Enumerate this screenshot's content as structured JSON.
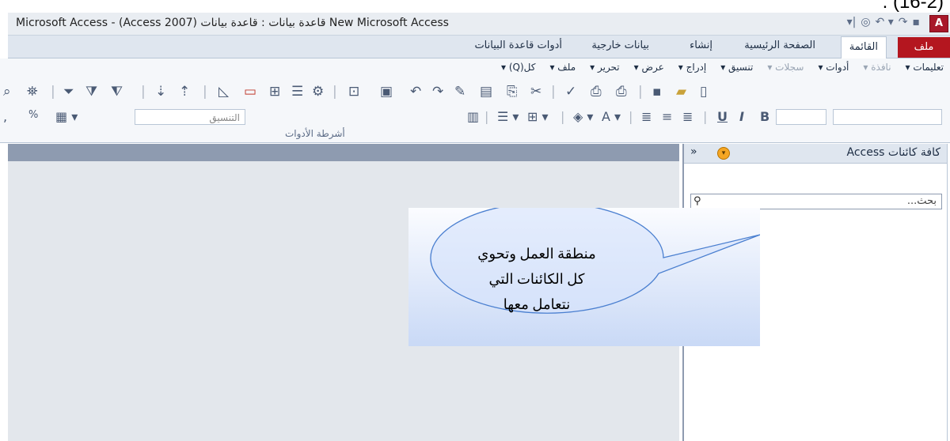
{
  "page": {
    "corner_caption": "(16-2) ."
  },
  "titlebar": {
    "title": "Microsoft Access - (Access 2007) قاعدة بيانات : قاعدة بيانات New Microsoft Access",
    "logo_letter": "A",
    "qat_icons": [
      "save-icon",
      "redo-icon",
      "undo-icon",
      "custom-icon",
      "customize-icon"
    ]
  },
  "tabs": {
    "file": "ملف",
    "items": [
      "القائمة",
      "الصفحة الرئيسية",
      "إنشاء",
      "بيانات خارجية",
      "أدوات قاعدة البيانات"
    ]
  },
  "menu": {
    "items": [
      "كل(Q) ▾",
      "ملف ▾",
      "تحرير ▾",
      "عرض ▾",
      "إدراج ▾",
      "تنسيق ▾",
      "سجلات ▾",
      "أدوات ▾",
      "نافذة ▾",
      "تعليمات ▾"
    ],
    "disabled": [
      6,
      8
    ]
  },
  "format_row": {
    "font_combo": "",
    "size_combo": "",
    "format_combo": "التنسيق",
    "percent": "%",
    "comma": ","
  },
  "ribbon": {
    "group_label": "أشرطة الأدوات"
  },
  "nav": {
    "title": "كافة كائنات Access",
    "chevron": "»",
    "search_placeholder": "بحث..."
  },
  "callout": {
    "lines": [
      "منطقة العمل وتحوي",
      "كل الكائنات التي",
      "نتعامل معها"
    ]
  },
  "colors": {
    "accent_red": "#b4161f",
    "nav_bar": "#8e9bb0"
  }
}
